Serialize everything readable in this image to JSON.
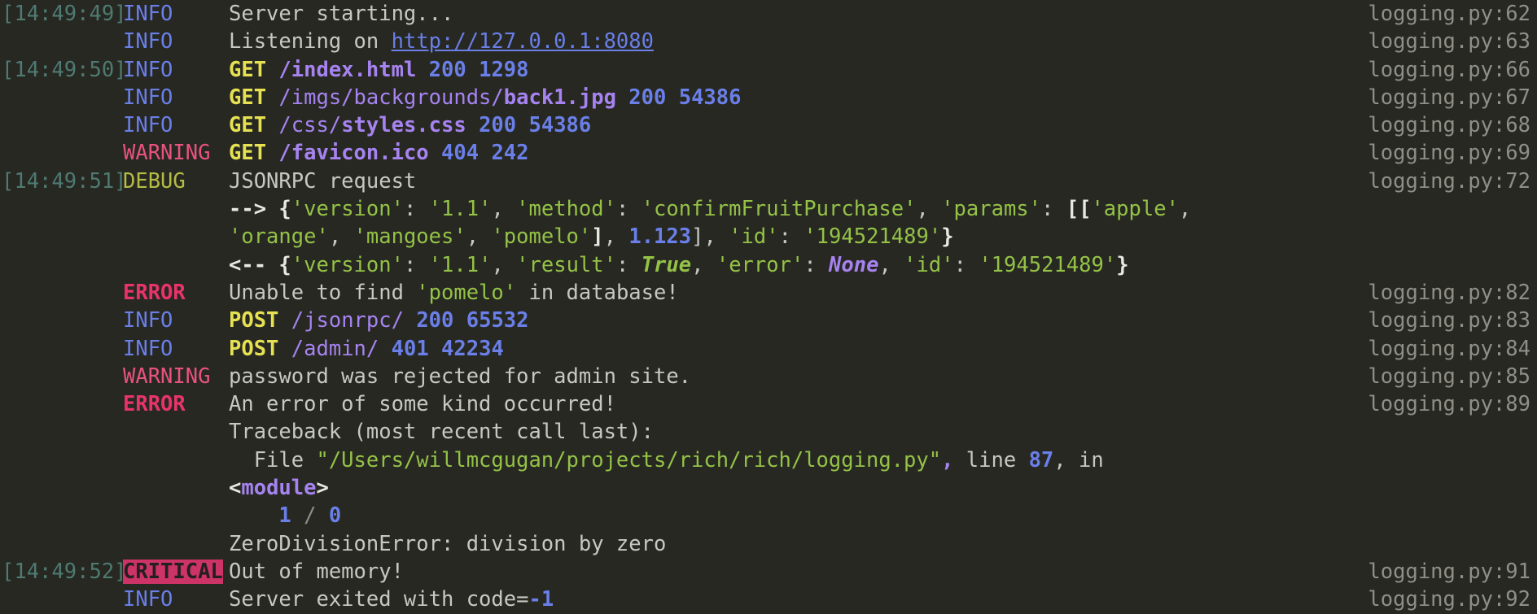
{
  "terminal": {
    "background": "#272822",
    "columns": {
      "time_header": "",
      "level_header": "",
      "message_header": "",
      "source_header": ""
    },
    "colors": {
      "text": "#c8c8c2",
      "dim": "#8f8f87",
      "time": "#4e7a72",
      "info": "#6a7fe8",
      "debug": "#b5bd45",
      "warning": "#e8527f",
      "error": "#e8336b",
      "critical_bg": "#cc3366",
      "critical_fg": "#241f20",
      "string": "#94c247",
      "number": "#6a7fe8",
      "path": "#a683f0",
      "verb": "#e6e152"
    }
  },
  "rows": [
    {
      "time": "[14:49:49]",
      "level": "INFO",
      "level_class": "lv-info",
      "source": "logging.py:62",
      "tokens": [
        {
          "text": "Server starting...",
          "cls": "t-plain"
        }
      ]
    },
    {
      "time": "",
      "level": "INFO",
      "level_class": "lv-info",
      "source": "logging.py:63",
      "tokens": [
        {
          "text": "Listening on ",
          "cls": "t-plain"
        },
        {
          "text": "http://127.0.0.1:8080",
          "cls": "t-link"
        }
      ]
    },
    {
      "time": "[14:49:50]",
      "level": "INFO",
      "level_class": "lv-info",
      "source": "logging.py:66",
      "tokens": [
        {
          "text": "GET",
          "cls": "t-verb"
        },
        {
          "text": " ",
          "cls": "t-plain"
        },
        {
          "text": "/index.html",
          "cls": "t-pathb"
        },
        {
          "text": " ",
          "cls": "t-plain"
        },
        {
          "text": "200",
          "cls": "t-num"
        },
        {
          "text": " ",
          "cls": "t-plain"
        },
        {
          "text": "1298",
          "cls": "t-num"
        }
      ]
    },
    {
      "time": "",
      "level": "INFO",
      "level_class": "lv-info",
      "source": "logging.py:67",
      "tokens": [
        {
          "text": "GET",
          "cls": "t-verb"
        },
        {
          "text": " ",
          "cls": "t-plain"
        },
        {
          "text": "/imgs/backgrounds/",
          "cls": "t-path"
        },
        {
          "text": "back1.jpg",
          "cls": "t-pathb"
        },
        {
          "text": " ",
          "cls": "t-plain"
        },
        {
          "text": "200",
          "cls": "t-num"
        },
        {
          "text": " ",
          "cls": "t-plain"
        },
        {
          "text": "54386",
          "cls": "t-num"
        }
      ]
    },
    {
      "time": "",
      "level": "INFO",
      "level_class": "lv-info",
      "source": "logging.py:68",
      "tokens": [
        {
          "text": "GET",
          "cls": "t-verb"
        },
        {
          "text": " ",
          "cls": "t-plain"
        },
        {
          "text": "/css/",
          "cls": "t-path"
        },
        {
          "text": "styles.css",
          "cls": "t-pathb"
        },
        {
          "text": " ",
          "cls": "t-plain"
        },
        {
          "text": "200",
          "cls": "t-num"
        },
        {
          "text": " ",
          "cls": "t-plain"
        },
        {
          "text": "54386",
          "cls": "t-num"
        }
      ]
    },
    {
      "time": "",
      "level": "WARNING",
      "level_class": "lv-warning",
      "source": "logging.py:69",
      "tokens": [
        {
          "text": "GET",
          "cls": "t-verb"
        },
        {
          "text": " ",
          "cls": "t-plain"
        },
        {
          "text": "/favicon.ico",
          "cls": "t-pathb"
        },
        {
          "text": " ",
          "cls": "t-plain"
        },
        {
          "text": "404",
          "cls": "t-num"
        },
        {
          "text": " ",
          "cls": "t-plain"
        },
        {
          "text": "242",
          "cls": "t-num"
        }
      ]
    },
    {
      "time": "[14:49:51]",
      "level": "DEBUG",
      "level_class": "lv-debug",
      "source": "logging.py:72",
      "tokens": [
        {
          "text": "JSONRPC request",
          "cls": "t-plain"
        }
      ]
    },
    {
      "time": "",
      "level": "",
      "level_class": "",
      "source": "",
      "tokens": [
        {
          "text": "--> ",
          "cls": "t-arrow"
        },
        {
          "text": "{",
          "cls": "t-brace"
        },
        {
          "text": "'version'",
          "cls": "t-str"
        },
        {
          "text": ": ",
          "cls": "t-punct"
        },
        {
          "text": "'1.1'",
          "cls": "t-str"
        },
        {
          "text": ", ",
          "cls": "t-punct"
        },
        {
          "text": "'method'",
          "cls": "t-str"
        },
        {
          "text": ": ",
          "cls": "t-punct"
        },
        {
          "text": "'confirmFruitPurchase'",
          "cls": "t-str"
        },
        {
          "text": ", ",
          "cls": "t-punct"
        },
        {
          "text": "'params'",
          "cls": "t-str"
        },
        {
          "text": ": ",
          "cls": "t-punct"
        },
        {
          "text": "[[",
          "cls": "t-brace"
        },
        {
          "text": "'apple'",
          "cls": "t-str"
        },
        {
          "text": ",",
          "cls": "t-punct"
        }
      ]
    },
    {
      "time": "",
      "level": "",
      "level_class": "",
      "source": "",
      "tokens": [
        {
          "text": "'orange'",
          "cls": "t-str"
        },
        {
          "text": ", ",
          "cls": "t-punct"
        },
        {
          "text": "'mangoes'",
          "cls": "t-str"
        },
        {
          "text": ", ",
          "cls": "t-punct"
        },
        {
          "text": "'pomelo'",
          "cls": "t-str"
        },
        {
          "text": "]",
          "cls": "t-brace"
        },
        {
          "text": ", ",
          "cls": "t-punct"
        },
        {
          "text": "1.123",
          "cls": "t-num"
        },
        {
          "text": "]",
          "cls": "t-punct"
        },
        {
          "text": ", ",
          "cls": "t-punct"
        },
        {
          "text": "'id'",
          "cls": "t-str"
        },
        {
          "text": ": ",
          "cls": "t-punct"
        },
        {
          "text": "'194521489'",
          "cls": "t-str"
        },
        {
          "text": "}",
          "cls": "t-brace"
        }
      ]
    },
    {
      "time": "",
      "level": "",
      "level_class": "",
      "source": "",
      "tokens": [
        {
          "text": "<-- ",
          "cls": "t-arrow"
        },
        {
          "text": "{",
          "cls": "t-brace"
        },
        {
          "text": "'version'",
          "cls": "t-str"
        },
        {
          "text": ": ",
          "cls": "t-punct"
        },
        {
          "text": "'1.1'",
          "cls": "t-str"
        },
        {
          "text": ", ",
          "cls": "t-punct"
        },
        {
          "text": "'result'",
          "cls": "t-str"
        },
        {
          "text": ": ",
          "cls": "t-punct"
        },
        {
          "text": "True",
          "cls": "t-bool"
        },
        {
          "text": ", ",
          "cls": "t-punct"
        },
        {
          "text": "'error'",
          "cls": "t-str"
        },
        {
          "text": ": ",
          "cls": "t-punct"
        },
        {
          "text": "None",
          "cls": "t-none"
        },
        {
          "text": ", ",
          "cls": "t-punct"
        },
        {
          "text": "'id'",
          "cls": "t-str"
        },
        {
          "text": ": ",
          "cls": "t-punct"
        },
        {
          "text": "'194521489'",
          "cls": "t-str"
        },
        {
          "text": "}",
          "cls": "t-brace"
        }
      ]
    },
    {
      "time": "",
      "level": "ERROR",
      "level_class": "lv-error",
      "source": "logging.py:82",
      "tokens": [
        {
          "text": "Unable to find ",
          "cls": "t-plain"
        },
        {
          "text": "'pomelo'",
          "cls": "t-str"
        },
        {
          "text": " in database!",
          "cls": "t-plain"
        }
      ]
    },
    {
      "time": "",
      "level": "INFO",
      "level_class": "lv-info",
      "source": "logging.py:83",
      "tokens": [
        {
          "text": "POST",
          "cls": "t-verb"
        },
        {
          "text": " ",
          "cls": "t-plain"
        },
        {
          "text": "/jsonrpc/",
          "cls": "t-path"
        },
        {
          "text": " ",
          "cls": "t-plain"
        },
        {
          "text": "200",
          "cls": "t-num"
        },
        {
          "text": " ",
          "cls": "t-plain"
        },
        {
          "text": "65532",
          "cls": "t-num"
        }
      ]
    },
    {
      "time": "",
      "level": "INFO",
      "level_class": "lv-info",
      "source": "logging.py:84",
      "tokens": [
        {
          "text": "POST",
          "cls": "t-verb"
        },
        {
          "text": " ",
          "cls": "t-plain"
        },
        {
          "text": "/admin/",
          "cls": "t-path"
        },
        {
          "text": " ",
          "cls": "t-plain"
        },
        {
          "text": "401",
          "cls": "t-num"
        },
        {
          "text": " ",
          "cls": "t-plain"
        },
        {
          "text": "42234",
          "cls": "t-num"
        }
      ]
    },
    {
      "time": "",
      "level": "WARNING",
      "level_class": "lv-warning",
      "source": "logging.py:85",
      "tokens": [
        {
          "text": "password was rejected for admin site.",
          "cls": "t-plain"
        }
      ]
    },
    {
      "time": "",
      "level": "ERROR",
      "level_class": "lv-error",
      "source": "logging.py:89",
      "tokens": [
        {
          "text": "An error of some kind occurred!",
          "cls": "t-plain"
        }
      ]
    },
    {
      "time": "",
      "level": "",
      "level_class": "",
      "source": "",
      "tokens": [
        {
          "text": "Traceback (most recent call last):",
          "cls": "t-plain"
        }
      ]
    },
    {
      "time": "",
      "level": "",
      "level_class": "",
      "source": "",
      "tokens": [
        {
          "text": "  File ",
          "cls": "t-plain"
        },
        {
          "text": "\"/Users/willmcgugan/projects/rich/rich/logging.py\"",
          "cls": "t-str"
        },
        {
          "text": ",",
          "cls": "t-comma"
        },
        {
          "text": " line ",
          "cls": "t-plain"
        },
        {
          "text": "87",
          "cls": "t-num"
        },
        {
          "text": ", in",
          "cls": "t-plain"
        }
      ]
    },
    {
      "time": "",
      "level": "",
      "level_class": "",
      "source": "",
      "tokens": [
        {
          "text": "<",
          "cls": "t-angle"
        },
        {
          "text": "module",
          "cls": "t-mod"
        },
        {
          "text": ">",
          "cls": "t-angle"
        }
      ]
    },
    {
      "time": "",
      "level": "",
      "level_class": "",
      "source": "",
      "tokens": [
        {
          "text": "    ",
          "cls": "t-plain"
        },
        {
          "text": "1",
          "cls": "t-num"
        },
        {
          "text": " / ",
          "cls": "t-slash"
        },
        {
          "text": "0",
          "cls": "t-num"
        }
      ]
    },
    {
      "time": "",
      "level": "",
      "level_class": "",
      "source": "",
      "tokens": [
        {
          "text": "ZeroDivisionError: division by zero",
          "cls": "t-plain"
        }
      ]
    },
    {
      "time": "[14:49:52]",
      "level": "CRITICAL",
      "level_class": "lv-critical",
      "source": "logging.py:91",
      "tokens": [
        {
          "text": "Out of memory!",
          "cls": "t-plain"
        }
      ]
    },
    {
      "time": "",
      "level": "INFO",
      "level_class": "lv-info",
      "source": "logging.py:92",
      "tokens": [
        {
          "text": "Server exited with code=",
          "cls": "t-plain"
        },
        {
          "text": "-1",
          "cls": "t-num"
        }
      ]
    }
  ]
}
